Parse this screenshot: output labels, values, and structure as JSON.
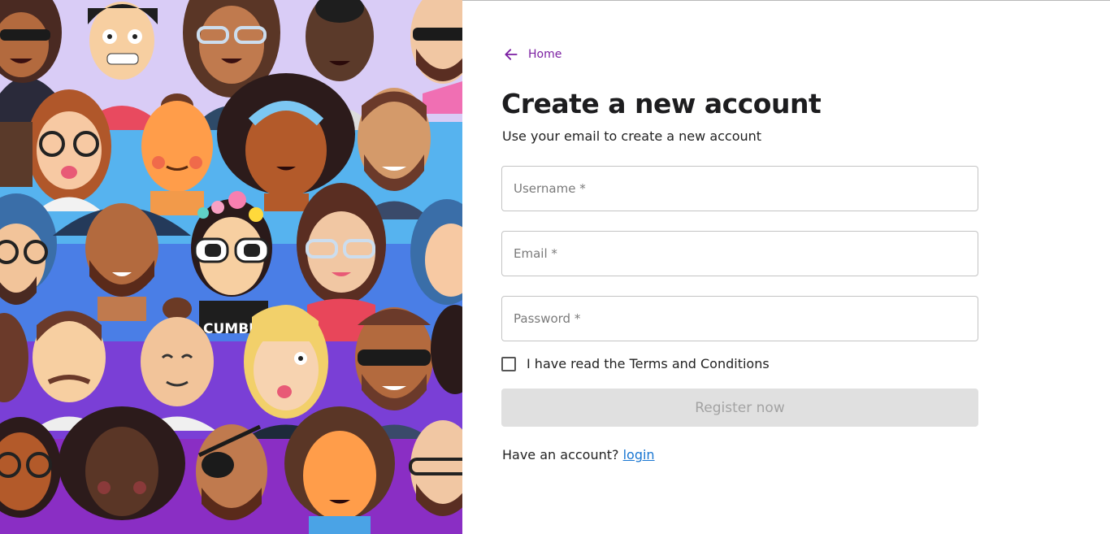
{
  "nav": {
    "home_label": "Home"
  },
  "heading": {
    "title": "Create a new account",
    "subtitle": "Use your email to create a new account"
  },
  "form": {
    "username_placeholder": "Username *",
    "email_placeholder": "Email *",
    "password_placeholder": "Password *",
    "terms_label": "I have read the Terms and Conditions",
    "terms_checked": false,
    "register_label": "Register now",
    "register_enabled": false
  },
  "footer": {
    "prompt": "Have an account?",
    "login_label": "login"
  },
  "illustration": {
    "shirt_text": "CUMBIA"
  },
  "colors": {
    "accent": "#7b1fa2",
    "link": "#1976d2",
    "disabled_bg": "#e0e0e0",
    "disabled_text": "#a3a3a3"
  }
}
